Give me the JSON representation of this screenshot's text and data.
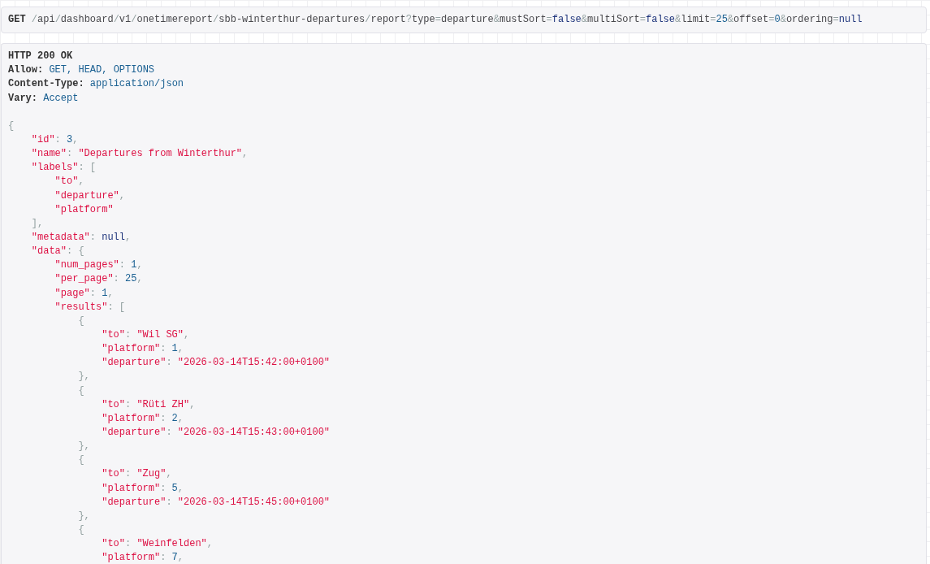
{
  "request": {
    "method": "GET",
    "url": [
      {
        "kind": "punct",
        "text": "/"
      },
      {
        "kind": "plain",
        "text": "api"
      },
      {
        "kind": "punct",
        "text": "/"
      },
      {
        "kind": "plain",
        "text": "dashboard"
      },
      {
        "kind": "punct",
        "text": "/"
      },
      {
        "kind": "plain",
        "text": "v1"
      },
      {
        "kind": "punct",
        "text": "/"
      },
      {
        "kind": "plain",
        "text": "onetimereport"
      },
      {
        "kind": "punct",
        "text": "/"
      },
      {
        "kind": "plain",
        "text": "sbb-winterthur-departures"
      },
      {
        "kind": "punct",
        "text": "/"
      },
      {
        "kind": "plain",
        "text": "report"
      },
      {
        "kind": "punct",
        "text": "?"
      },
      {
        "kind": "plain",
        "text": "type"
      },
      {
        "kind": "punct",
        "text": "="
      },
      {
        "kind": "plain",
        "text": "departure"
      },
      {
        "kind": "punct",
        "text": "&"
      },
      {
        "kind": "plain",
        "text": "mustSort"
      },
      {
        "kind": "punct",
        "text": "="
      },
      {
        "kind": "keyword",
        "text": "false"
      },
      {
        "kind": "punct",
        "text": "&"
      },
      {
        "kind": "plain",
        "text": "multiSort"
      },
      {
        "kind": "punct",
        "text": "="
      },
      {
        "kind": "keyword",
        "text": "false"
      },
      {
        "kind": "punct",
        "text": "&"
      },
      {
        "kind": "plain",
        "text": "limit"
      },
      {
        "kind": "punct",
        "text": "="
      },
      {
        "kind": "number",
        "text": "25"
      },
      {
        "kind": "punct",
        "text": "&"
      },
      {
        "kind": "plain",
        "text": "offset"
      },
      {
        "kind": "punct",
        "text": "="
      },
      {
        "kind": "number",
        "text": "0"
      },
      {
        "kind": "punct",
        "text": "&"
      },
      {
        "kind": "plain",
        "text": "ordering"
      },
      {
        "kind": "punct",
        "text": "="
      },
      {
        "kind": "keyword",
        "text": "null"
      }
    ]
  },
  "response": {
    "status": "HTTP 200 OK",
    "headers": [
      {
        "name": "Allow:",
        "value": "GET, HEAD, OPTIONS"
      },
      {
        "name": "Content-Type:",
        "value": "application/json"
      },
      {
        "name": "Vary:",
        "value": "Accept"
      }
    ],
    "body": [
      {
        "tokens": [
          {
            "kind": "punct",
            "text": "{"
          }
        ],
        "children": [
          {
            "tokens": [
              {
                "kind": "string",
                "text": "\"id\""
              },
              {
                "kind": "punct",
                "text": ": "
              },
              {
                "kind": "number",
                "text": "3"
              },
              {
                "kind": "punct",
                "text": ","
              }
            ]
          },
          {
            "tokens": [
              {
                "kind": "string",
                "text": "\"name\""
              },
              {
                "kind": "punct",
                "text": ": "
              },
              {
                "kind": "string",
                "text": "\"Departures from Winterthur\""
              },
              {
                "kind": "punct",
                "text": ","
              }
            ]
          },
          {
            "tokens": [
              {
                "kind": "string",
                "text": "\"labels\""
              },
              {
                "kind": "punct",
                "text": ": ["
              }
            ],
            "children": [
              {
                "tokens": [
                  {
                    "kind": "string",
                    "text": "\"to\""
                  },
                  {
                    "kind": "punct",
                    "text": ","
                  }
                ]
              },
              {
                "tokens": [
                  {
                    "kind": "string",
                    "text": "\"departure\""
                  },
                  {
                    "kind": "punct",
                    "text": ","
                  }
                ]
              },
              {
                "tokens": [
                  {
                    "kind": "string",
                    "text": "\"platform\""
                  }
                ]
              }
            ]
          },
          {
            "tokens": [
              {
                "kind": "punct",
                "text": "],"
              }
            ]
          },
          {
            "tokens": [
              {
                "kind": "string",
                "text": "\"metadata\""
              },
              {
                "kind": "punct",
                "text": ": "
              },
              {
                "kind": "keyword",
                "text": "null"
              },
              {
                "kind": "punct",
                "text": ","
              }
            ]
          },
          {
            "tokens": [
              {
                "kind": "string",
                "text": "\"data\""
              },
              {
                "kind": "punct",
                "text": ": {"
              }
            ],
            "children": [
              {
                "tokens": [
                  {
                    "kind": "string",
                    "text": "\"num_pages\""
                  },
                  {
                    "kind": "punct",
                    "text": ": "
                  },
                  {
                    "kind": "number",
                    "text": "1"
                  },
                  {
                    "kind": "punct",
                    "text": ","
                  }
                ]
              },
              {
                "tokens": [
                  {
                    "kind": "string",
                    "text": "\"per_page\""
                  },
                  {
                    "kind": "punct",
                    "text": ": "
                  },
                  {
                    "kind": "number",
                    "text": "25"
                  },
                  {
                    "kind": "punct",
                    "text": ","
                  }
                ]
              },
              {
                "tokens": [
                  {
                    "kind": "string",
                    "text": "\"page\""
                  },
                  {
                    "kind": "punct",
                    "text": ": "
                  },
                  {
                    "kind": "number",
                    "text": "1"
                  },
                  {
                    "kind": "punct",
                    "text": ","
                  }
                ]
              },
              {
                "tokens": [
                  {
                    "kind": "string",
                    "text": "\"results\""
                  },
                  {
                    "kind": "punct",
                    "text": ": ["
                  }
                ],
                "children": [
                  {
                    "tokens": [
                      {
                        "kind": "punct",
                        "text": "{"
                      }
                    ],
                    "children": [
                      {
                        "tokens": [
                          {
                            "kind": "string",
                            "text": "\"to\""
                          },
                          {
                            "kind": "punct",
                            "text": ": "
                          },
                          {
                            "kind": "string",
                            "text": "\"Wil SG\""
                          },
                          {
                            "kind": "punct",
                            "text": ","
                          }
                        ]
                      },
                      {
                        "tokens": [
                          {
                            "kind": "string",
                            "text": "\"platform\""
                          },
                          {
                            "kind": "punct",
                            "text": ": "
                          },
                          {
                            "kind": "number",
                            "text": "1"
                          },
                          {
                            "kind": "punct",
                            "text": ","
                          }
                        ]
                      },
                      {
                        "tokens": [
                          {
                            "kind": "string",
                            "text": "\"departure\""
                          },
                          {
                            "kind": "punct",
                            "text": ": "
                          },
                          {
                            "kind": "string",
                            "text": "\"2026-03-14T15:42:00+0100\""
                          }
                        ]
                      }
                    ]
                  },
                  {
                    "tokens": [
                      {
                        "kind": "punct",
                        "text": "},"
                      }
                    ]
                  },
                  {
                    "tokens": [
                      {
                        "kind": "punct",
                        "text": "{"
                      }
                    ],
                    "children": [
                      {
                        "tokens": [
                          {
                            "kind": "string",
                            "text": "\"to\""
                          },
                          {
                            "kind": "punct",
                            "text": ": "
                          },
                          {
                            "kind": "string",
                            "text": "\"Rüti ZH\""
                          },
                          {
                            "kind": "punct",
                            "text": ","
                          }
                        ]
                      },
                      {
                        "tokens": [
                          {
                            "kind": "string",
                            "text": "\"platform\""
                          },
                          {
                            "kind": "punct",
                            "text": ": "
                          },
                          {
                            "kind": "number",
                            "text": "2"
                          },
                          {
                            "kind": "punct",
                            "text": ","
                          }
                        ]
                      },
                      {
                        "tokens": [
                          {
                            "kind": "string",
                            "text": "\"departure\""
                          },
                          {
                            "kind": "punct",
                            "text": ": "
                          },
                          {
                            "kind": "string",
                            "text": "\"2026-03-14T15:43:00+0100\""
                          }
                        ]
                      }
                    ]
                  },
                  {
                    "tokens": [
                      {
                        "kind": "punct",
                        "text": "},"
                      }
                    ]
                  },
                  {
                    "tokens": [
                      {
                        "kind": "punct",
                        "text": "{"
                      }
                    ],
                    "children": [
                      {
                        "tokens": [
                          {
                            "kind": "string",
                            "text": "\"to\""
                          },
                          {
                            "kind": "punct",
                            "text": ": "
                          },
                          {
                            "kind": "string",
                            "text": "\"Zug\""
                          },
                          {
                            "kind": "punct",
                            "text": ","
                          }
                        ]
                      },
                      {
                        "tokens": [
                          {
                            "kind": "string",
                            "text": "\"platform\""
                          },
                          {
                            "kind": "punct",
                            "text": ": "
                          },
                          {
                            "kind": "number",
                            "text": "5"
                          },
                          {
                            "kind": "punct",
                            "text": ","
                          }
                        ]
                      },
                      {
                        "tokens": [
                          {
                            "kind": "string",
                            "text": "\"departure\""
                          },
                          {
                            "kind": "punct",
                            "text": ": "
                          },
                          {
                            "kind": "string",
                            "text": "\"2026-03-14T15:45:00+0100\""
                          }
                        ]
                      }
                    ]
                  },
                  {
                    "tokens": [
                      {
                        "kind": "punct",
                        "text": "},"
                      }
                    ]
                  },
                  {
                    "tokens": [
                      {
                        "kind": "punct",
                        "text": "{"
                      }
                    ],
                    "children": [
                      {
                        "tokens": [
                          {
                            "kind": "string",
                            "text": "\"to\""
                          },
                          {
                            "kind": "punct",
                            "text": ": "
                          },
                          {
                            "kind": "string",
                            "text": "\"Weinfelden\""
                          },
                          {
                            "kind": "punct",
                            "text": ","
                          }
                        ]
                      },
                      {
                        "tokens": [
                          {
                            "kind": "string",
                            "text": "\"platform\""
                          },
                          {
                            "kind": "punct",
                            "text": ": "
                          },
                          {
                            "kind": "number",
                            "text": "7"
                          },
                          {
                            "kind": "punct",
                            "text": ","
                          }
                        ]
                      }
                    ]
                  }
                ]
              }
            ]
          }
        ]
      }
    ]
  }
}
